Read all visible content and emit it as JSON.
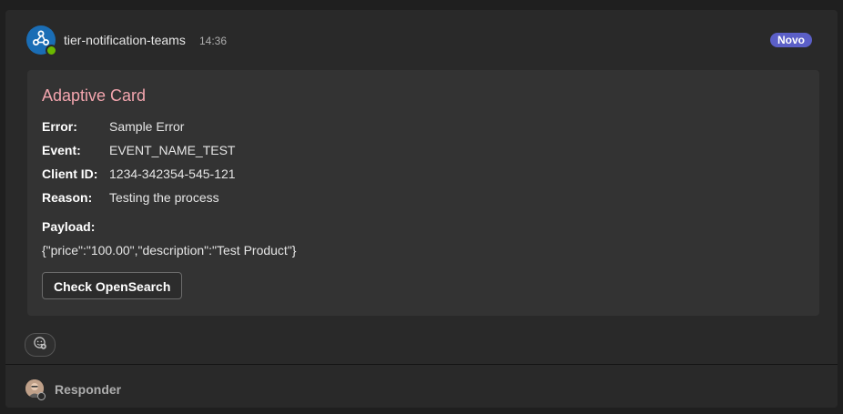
{
  "message": {
    "sender": "tier-notification-teams",
    "time": "14:36",
    "badge": "Novo",
    "avatar_icon": "webhook-icon"
  },
  "card": {
    "title": "Adaptive Card",
    "facts": [
      {
        "key": "Error:",
        "value": "Sample Error"
      },
      {
        "key": "Event:",
        "value": "EVENT_NAME_TEST"
      },
      {
        "key": "Client ID:",
        "value": "1234-342354-545-121"
      },
      {
        "key": "Reason:",
        "value": "Testing the process"
      }
    ],
    "payload_label": "Payload:",
    "payload_value": "{\"price\":\"100.00\",\"description\":\"Test Product\"}",
    "action_label": "Check OpenSearch"
  },
  "reaction": {
    "icon": "add-reaction-icon"
  },
  "reply": {
    "label": "Responder"
  },
  "colors": {
    "accent": "#5b5fc7",
    "card_title": "#f3a5ae",
    "status_available": "#6bb700"
  }
}
